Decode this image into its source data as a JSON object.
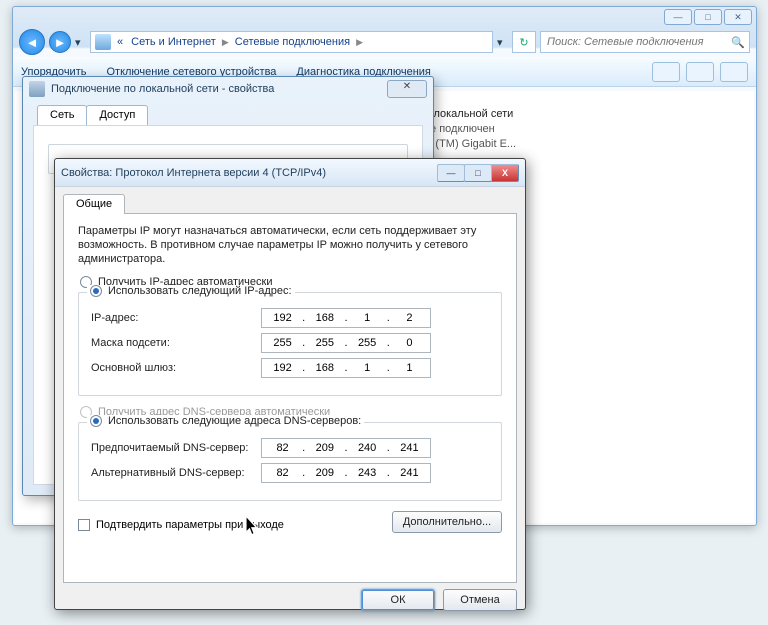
{
  "explorer": {
    "breadcrumb": {
      "item1": "Сеть и Интернет",
      "item2": "Сетевые подключения"
    },
    "search_placeholder": "Поиск: Сетевые подключения",
    "toolbar": {
      "item1": "Упорядочить",
      "item2": "Отключение сетевого устройства",
      "item3": "Диагностика подключения"
    },
    "connection": {
      "name": "ие по локальной сети",
      "status": "ель не подключен",
      "adapter": "etLink (TM) Gigabit E..."
    }
  },
  "lan_dialog": {
    "title": "Подключение по локальной сети - свойства",
    "tabs": {
      "t1": "Сеть",
      "t2": "Доступ"
    }
  },
  "ipv4": {
    "title": "Свойства: Протокол Интернета версии 4 (TCP/IPv4)",
    "tab": "Общие",
    "desc": "Параметры IP могут назначаться автоматически, если сеть поддерживает эту возможность. В противном случае параметры IP можно получить у сетевого администратора.",
    "radio_auto_ip": "Получить IP-адрес автоматически",
    "radio_manual_ip": "Использовать следующий IP-адрес:",
    "lbl_ip": "IP-адрес:",
    "lbl_mask": "Маска подсети:",
    "lbl_gw": "Основной шлюз:",
    "ip": {
      "o1": "192",
      "o2": "168",
      "o3": "1",
      "o4": "2"
    },
    "mask": {
      "o1": "255",
      "o2": "255",
      "o3": "255",
      "o4": "0"
    },
    "gw": {
      "o1": "192",
      "o2": "168",
      "o3": "1",
      "o4": "1"
    },
    "radio_auto_dns": "Получить адрес DNS-сервера автоматически",
    "radio_manual_dns": "Использовать следующие адреса DNS-серверов:",
    "lbl_dns1": "Предпочитаемый DNS-сервер:",
    "lbl_dns2": "Альтернативный DNS-сервер:",
    "dns1": {
      "o1": "82",
      "o2": "209",
      "o3": "240",
      "o4": "241"
    },
    "dns2": {
      "o1": "82",
      "o2": "209",
      "o3": "243",
      "o4": "241"
    },
    "chk_validate": "Подтвердить параметры при выходе",
    "btn_advanced": "Дополнительно...",
    "btn_ok": "ОК",
    "btn_cancel": "Отмена"
  }
}
